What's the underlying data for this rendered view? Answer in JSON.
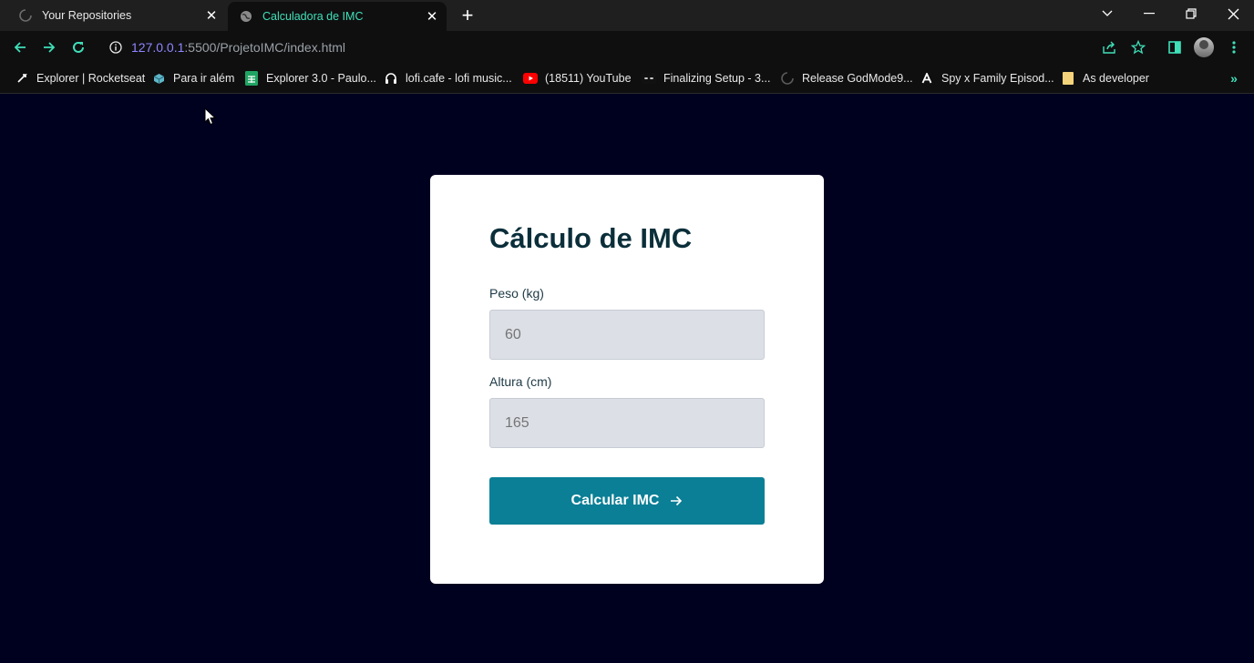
{
  "browser": {
    "tabs": [
      {
        "title": "Your Repositories",
        "active": false,
        "icon": "github-icon"
      },
      {
        "title": "Calculadora de IMC",
        "active": true,
        "icon": "globe-icon"
      }
    ],
    "address": {
      "host": "127.0.0.1",
      "rest": ":5500/ProjetoIMC/index.html"
    },
    "bookmarks": [
      {
        "label": "Explorer | Rocketseat",
        "icon": "rocketseat-icon"
      },
      {
        "label": "Para ir além",
        "icon": "cube-icon"
      },
      {
        "label": "Explorer 3.0 - Paulo...",
        "icon": "sheets-icon"
      },
      {
        "label": "lofi.cafe - lofi music...",
        "icon": "headphones-icon"
      },
      {
        "label": "(18511) YouTube",
        "icon": "youtube-icon"
      },
      {
        "label": "Finalizing Setup - 3...",
        "icon": "eyes-icon"
      },
      {
        "label": "Release GodMode9...",
        "icon": "github-icon"
      },
      {
        "label": "Spy x Family Episod...",
        "icon": "letter-a-icon"
      },
      {
        "label": "As developer",
        "icon": "folder-icon"
      }
    ],
    "colors": {
      "accent": "#3fe0b8",
      "chrome_bg": "#1f1f20",
      "toolbar_bg": "#0f0f10"
    }
  },
  "page": {
    "title": "Cálculo de IMC",
    "weight": {
      "label": "Peso (kg)",
      "placeholder": "60"
    },
    "height": {
      "label": "Altura (cm)",
      "placeholder": "165"
    },
    "submit_label": "Calcular IMC",
    "colors": {
      "background": "#00001f",
      "card": "#ffffff",
      "heading": "#0b2f3a",
      "input_bg": "#dce0e6",
      "button": "#0a7f96"
    }
  }
}
